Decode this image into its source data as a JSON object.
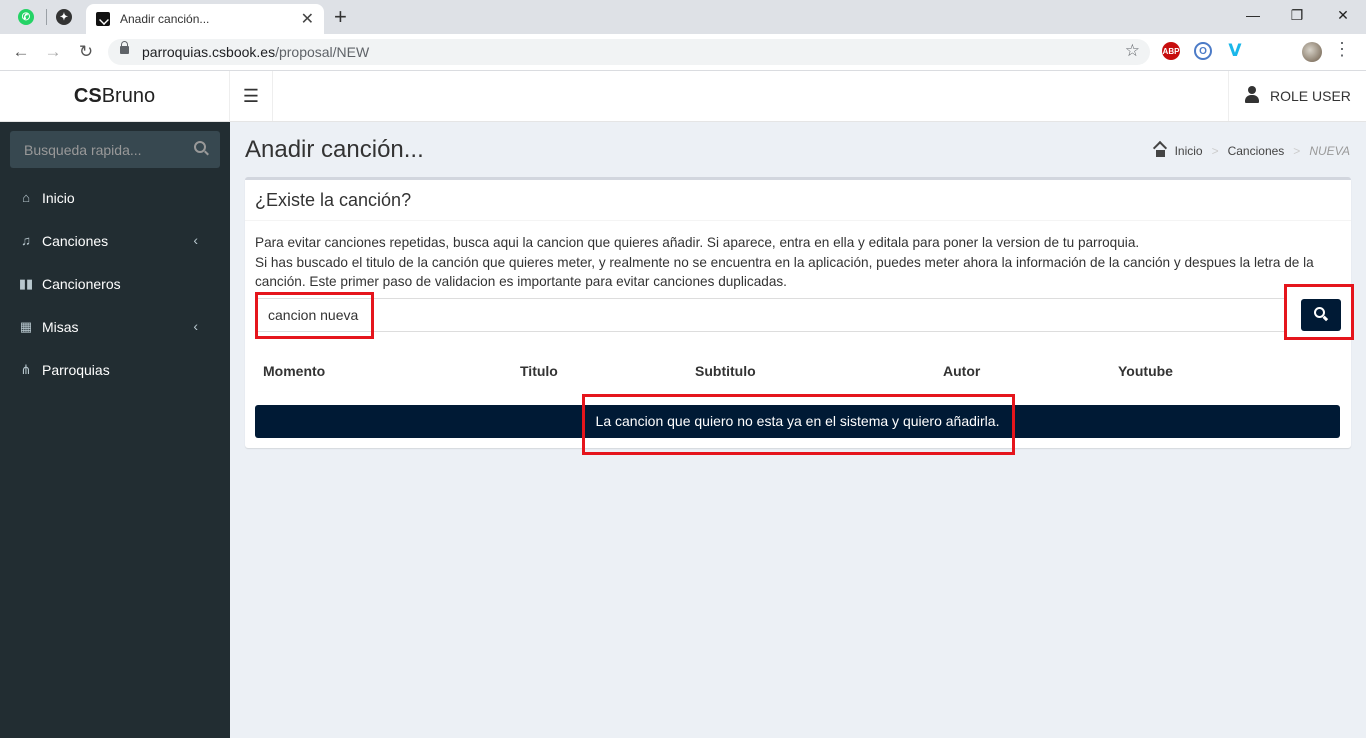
{
  "browser": {
    "tab_title": "Anadir canción...",
    "url_host": "parroquias.csbook.es",
    "url_path": "/proposal/NEW",
    "extensions": [
      "abp-icon",
      "o-icon",
      "v-icon",
      "windows-icon"
    ],
    "abp_label": "ABP"
  },
  "app": {
    "logo_bold": "CS",
    "logo_rest": "Bruno",
    "user_label": "ROLE USER"
  },
  "sidebar": {
    "search_placeholder": "Busqueda rapida...",
    "items": [
      {
        "label": "Inicio",
        "icon": "home-icon",
        "submenu": false
      },
      {
        "label": "Canciones",
        "icon": "music-icon",
        "submenu": true
      },
      {
        "label": "Cancioneros",
        "icon": "book-icon",
        "submenu": false
      },
      {
        "label": "Misas",
        "icon": "calendar-icon",
        "submenu": true
      },
      {
        "label": "Parroquias",
        "icon": "sitemap-icon",
        "submenu": false
      }
    ]
  },
  "page": {
    "title": "Anadir canción...",
    "breadcrumb": {
      "home": "Inicio",
      "section": "Canciones",
      "current": "NUEVA"
    }
  },
  "box": {
    "title": "¿Existe la canción?",
    "description_line1": "Para evitar canciones repetidas, busca aqui la cancion que quieres añadir. Si aparece, entra en ella y editala para poner la version de tu parroquia.",
    "description_line2": "Si has buscado el titulo de la canción que quieres meter, y realmente no se encuentra en la aplicación, puedes meter ahora la información de la canción y despues la letra de la canción. Este primer paso de validacion es importante para evitar canciones duplicadas.",
    "search_value": "cancion nueva",
    "columns": [
      "Momento",
      "Titulo",
      "Subtitulo",
      "Autor",
      "Youtube"
    ],
    "add_button_label": "La cancion que quiero no esta ya en el sistema y quiero añadirla."
  },
  "colors": {
    "sidebar_bg": "#222d32",
    "primary_button": "#001a35",
    "annotation_red": "#e5151c",
    "content_bg": "#ecf0f5"
  }
}
